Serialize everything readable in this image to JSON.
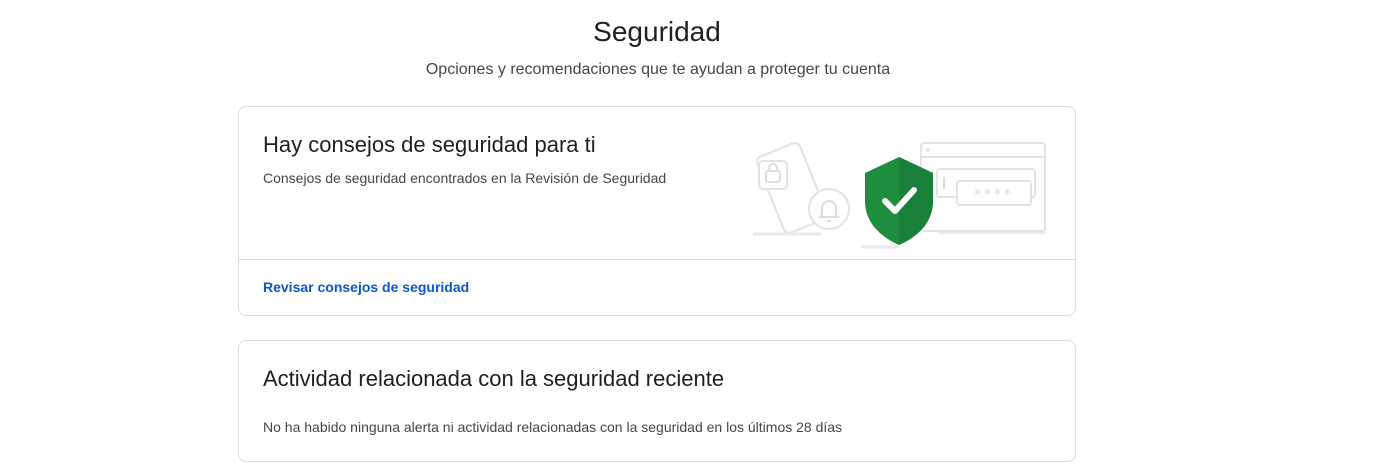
{
  "header": {
    "title": "Seguridad",
    "subtitle": "Opciones y recomendaciones que te ayudan a proteger tu cuenta"
  },
  "security_tips_card": {
    "title": "Hay consejos de seguridad para ti",
    "description": "Consejos de seguridad encontrados en la Revisión de Seguridad",
    "link_label": "Revisar consejos de seguridad",
    "illustration": {
      "icons": [
        "phone-lock-icon",
        "bell-icon",
        "shield-check-icon",
        "browser-password-icon"
      ],
      "password_mask": "****"
    }
  },
  "recent_activity_card": {
    "title": "Actividad relacionada con la seguridad reciente",
    "description": "No ha habido ninguna alerta ni actividad relacionadas con la seguridad en los últimos 28 días"
  },
  "colors": {
    "link": "#0b57d0",
    "shield": "#188038",
    "border": "#dadce0",
    "text_primary": "#1f1f1f",
    "text_secondary": "#444746"
  }
}
